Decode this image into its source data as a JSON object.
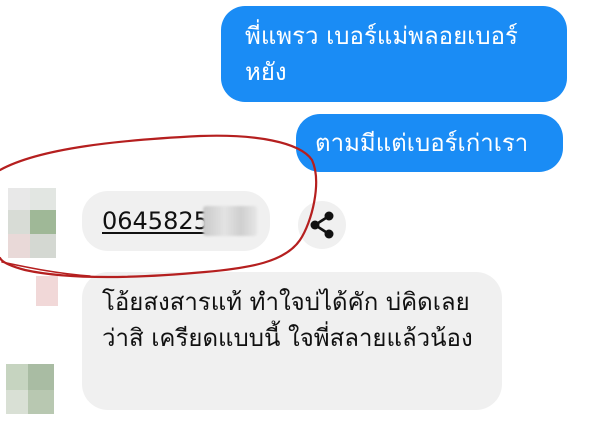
{
  "messages": [
    {
      "sender": "me",
      "text": "พี่แพรว เบอร์แม่พลอยเบอร์หยัง"
    },
    {
      "sender": "me",
      "text": "ตามมีแต่เบอร์เก่าเรา"
    },
    {
      "sender": "contact",
      "text": "0645825"
    },
    {
      "sender": "contact",
      "text": "โอ้ยสงสารแท้ ทำใจบ่ได้คัก บ่คิดเลย ว่าสิ เครียดแบบนี้ ใจพี่สลายแล้วน้อง"
    }
  ],
  "icons": {
    "share": "share-icon"
  },
  "colors": {
    "outgoing_bubble": "#1a8cf5",
    "incoming_bubble": "#f0f0f0",
    "annotation_circle": "#b51f1f"
  }
}
